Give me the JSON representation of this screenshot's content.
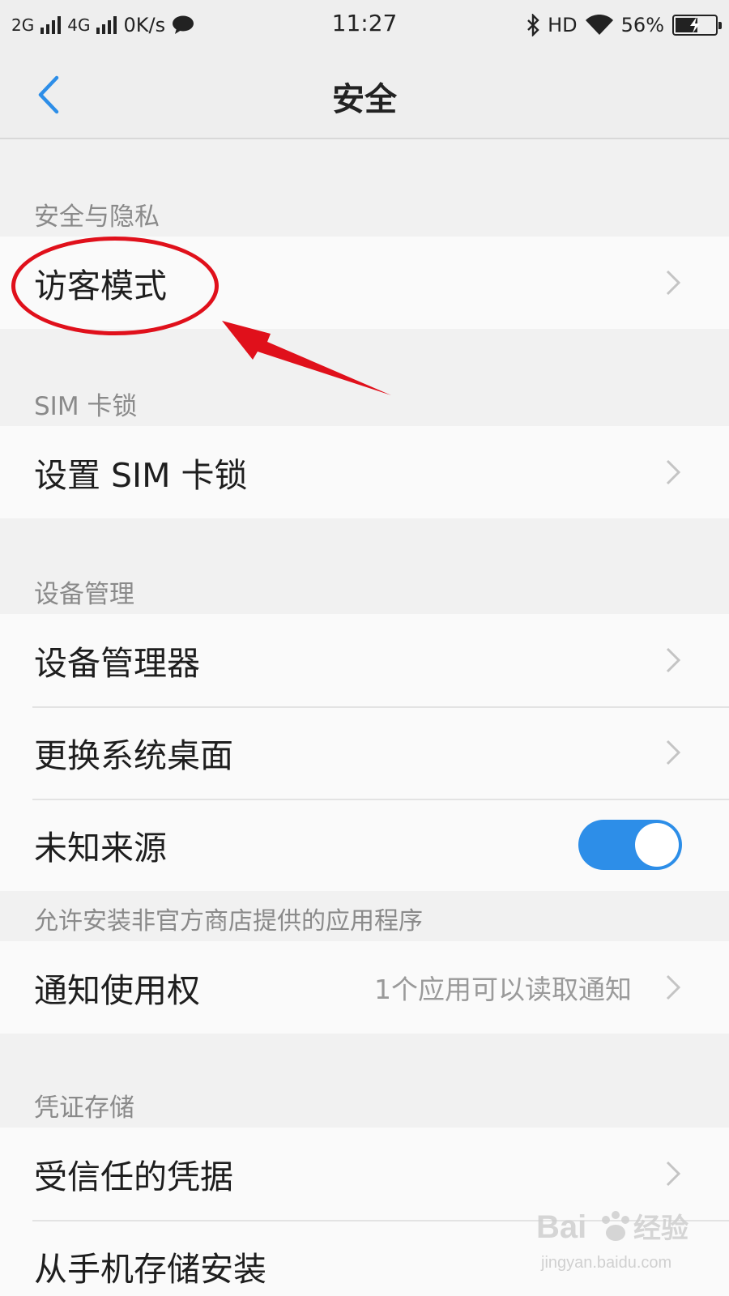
{
  "status_bar": {
    "net1": "2G",
    "net2": "4G",
    "speed": "0K/s",
    "time": "11:27",
    "hd": "HD",
    "battery": "56%",
    "battery_level": 0.56,
    "icons": [
      "signal-icon",
      "message-icon",
      "bluetooth-icon",
      "wifi-icon",
      "battery-icon"
    ]
  },
  "header": {
    "title": "安全",
    "back_icon": "chevron-left-icon"
  },
  "sections": {
    "privacy": {
      "title": "安全与隐私",
      "items": [
        {
          "label": "访客模式"
        }
      ]
    },
    "sim": {
      "title": "SIM 卡锁",
      "items": [
        {
          "label": "设置 SIM 卡锁"
        }
      ]
    },
    "device": {
      "title": "设备管理",
      "items": [
        {
          "label": "设备管理器"
        },
        {
          "label": "更换系统桌面"
        },
        {
          "label": "未知来源",
          "toggle_on": true
        }
      ],
      "hint": "允许安装非官方商店提供的应用程序"
    },
    "notify": {
      "items": [
        {
          "label": "通知使用权",
          "value": "1个应用可以读取通知"
        }
      ]
    },
    "credential": {
      "title": "凭证存储",
      "items": [
        {
          "label": "受信任的凭据"
        },
        {
          "label": "从手机存储安装"
        }
      ]
    }
  },
  "colors": {
    "accent": "#2d8ee8",
    "annotation": "#e0101b"
  },
  "watermark": {
    "text": "Bai 经验",
    "url": "jingyan.baidu.com"
  }
}
